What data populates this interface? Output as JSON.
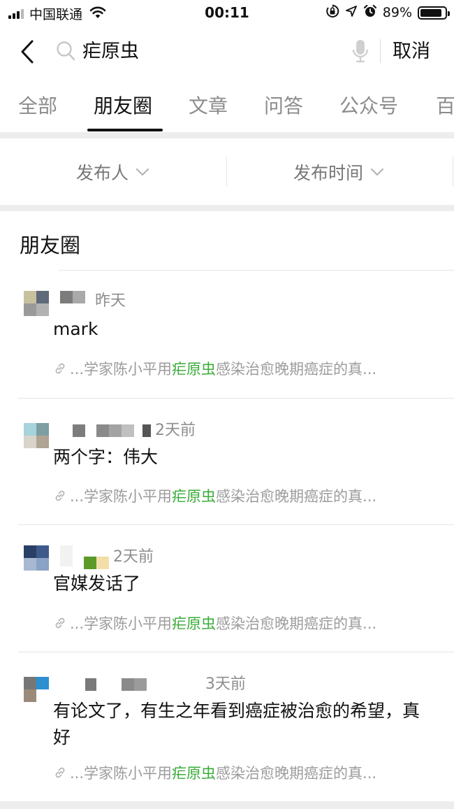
{
  "status_bar": {
    "carrier": "中国联通",
    "time": "00:11",
    "battery_percent": "89%",
    "battery_level": 0.89,
    "icons": [
      "signal-icon",
      "wifi-icon",
      "orientation-lock-icon",
      "location-icon",
      "alarm-icon",
      "battery-icon"
    ]
  },
  "search": {
    "query": "疟原虫",
    "cancel_label": "取消",
    "icons": [
      "back-icon",
      "search-icon",
      "microphone-icon"
    ]
  },
  "tabs": [
    {
      "label": "全部"
    },
    {
      "label": "朋友圈"
    },
    {
      "label": "文章"
    },
    {
      "label": "问答"
    },
    {
      "label": "公众号"
    },
    {
      "label": "百"
    }
  ],
  "active_tab": "朋友圈",
  "filters": [
    {
      "label": "发布人"
    },
    {
      "label": "发布时间"
    }
  ],
  "section_title": "朋友圈",
  "highlight_color": "#3aac3a",
  "posts": [
    {
      "time": "昨天",
      "text": "mark",
      "link_prefix": "...学家陈小平用",
      "link_highlight": "疟原虫",
      "link_suffix": "感染治愈晚期癌症的真..."
    },
    {
      "time": "2天前",
      "text": "两个字：伟大",
      "link_prefix": "...学家陈小平用",
      "link_highlight": "疟原虫",
      "link_suffix": "感染治愈晚期癌症的真..."
    },
    {
      "time": "2天前",
      "text": "官媒发话了",
      "link_prefix": "...学家陈小平用",
      "link_highlight": "疟原虫",
      "link_suffix": "感染治愈晚期癌症的真..."
    },
    {
      "time": "3天前",
      "text": "有论文了，有生之年看到癌症被治愈的希望，真好",
      "link_prefix": "...学家陈小平用",
      "link_highlight": "疟原虫",
      "link_suffix": "感染治愈晚期癌症的真..."
    }
  ]
}
